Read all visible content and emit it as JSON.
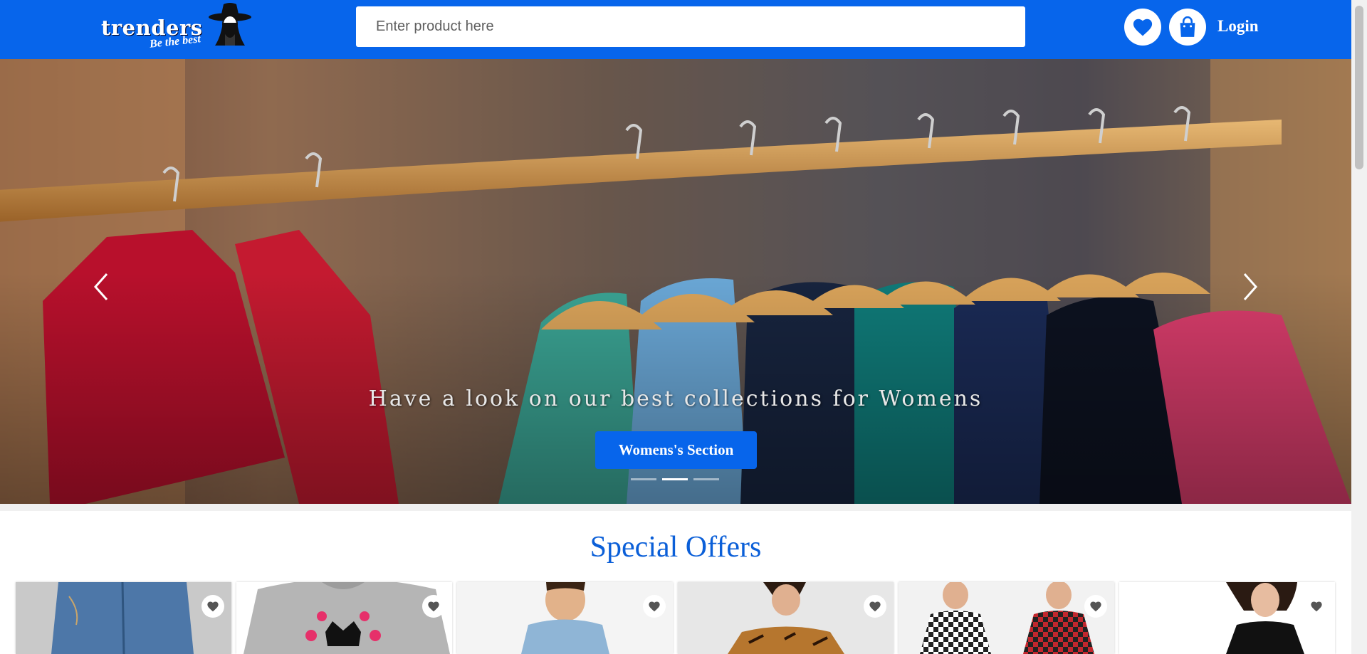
{
  "header": {
    "logo_text": "trenders",
    "logo_tagline": "Be the best",
    "search_placeholder": "Enter product here",
    "wishlist_icon": "heart-icon",
    "cart_icon": "shopping-bag-icon",
    "login_label": "Login"
  },
  "hero": {
    "caption": "Have a look on our best collections for Womens",
    "button_label": "Womens's Section",
    "prev_icon": "chevron-left-icon",
    "next_icon": "chevron-right-icon",
    "slides": 3,
    "active_slide": 2
  },
  "offers": {
    "title": "Special Offers",
    "products": [
      {
        "image": "jeans-product-image"
      },
      {
        "image": "crown-heart-tshirt-product-image"
      },
      {
        "image": "kids-denim-shirt-product-image"
      },
      {
        "image": "tiger-print-top-product-image"
      },
      {
        "image": "checked-shirts-product-image"
      },
      {
        "image": "black-top-product-image"
      }
    ]
  },
  "colors": {
    "brand_blue": "#0765eb",
    "title_blue": "#0b5fd8"
  }
}
